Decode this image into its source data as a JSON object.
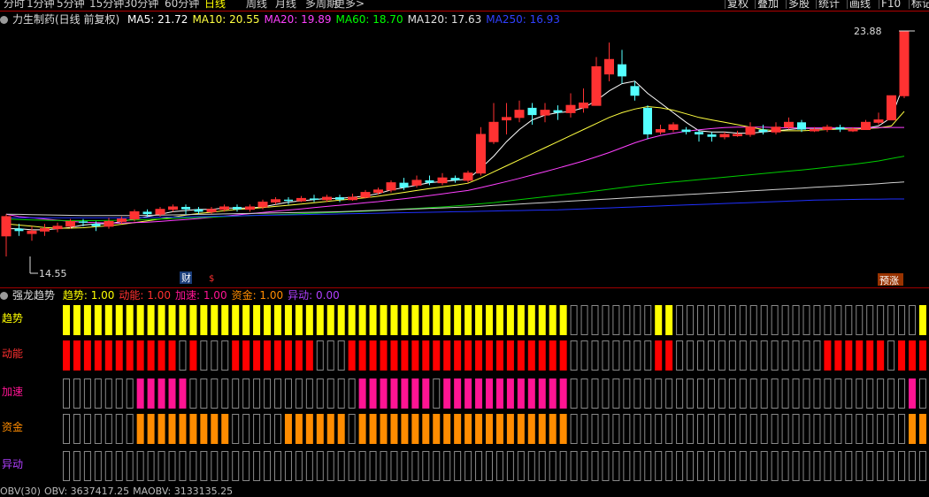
{
  "toolbar": {
    "periods": [
      "分时",
      "1分钟",
      "5分钟",
      "15分钟",
      "30分钟",
      "60分钟",
      "日线",
      "周线",
      "月线",
      "多周期",
      "更多>"
    ],
    "active_period": "日线",
    "buttons": [
      "复权",
      "叠加",
      "多股",
      "统计",
      "画线",
      "F10",
      "标记"
    ]
  },
  "header": {
    "stock": "力生制药(日线 前复权)",
    "ma": [
      {
        "text": "MA5: 21.72",
        "color": "#ffffff"
      },
      {
        "text": "MA10: 20.55",
        "color": "#ffff40"
      },
      {
        "text": "MA20: 19.89",
        "color": "#ff40ff"
      },
      {
        "text": "MA60: 18.70",
        "color": "#00ff00"
      },
      {
        "text": "MA120: 17.63",
        "color": "#e0e0e0"
      },
      {
        "text": "MA250: 16.93",
        "color": "#3040ff"
      }
    ]
  },
  "annotations": {
    "high": "23.88",
    "low": "14.55",
    "cai": "财",
    "dollar": "$",
    "yuzhang": "预涨"
  },
  "colors": {
    "up": "#ff3232",
    "down": "#54ffff",
    "trend": "#ffff00",
    "momentum": "#ff0000",
    "accel": "#ff1493",
    "capital": "#ff8c00",
    "empty": "#888888"
  },
  "candles": [
    [
      15.4,
      16.2,
      16.3,
      14.55
    ],
    [
      15.7,
      15.6,
      15.9,
      15.4
    ],
    [
      15.5,
      15.6,
      15.8,
      15.2
    ],
    [
      15.6,
      15.7,
      15.9,
      15.4
    ],
    [
      15.7,
      15.8,
      15.95,
      15.55
    ],
    [
      15.8,
      16.0,
      16.1,
      15.7
    ],
    [
      16.0,
      15.95,
      16.1,
      15.8
    ],
    [
      15.9,
      15.8,
      16.0,
      15.6
    ],
    [
      15.8,
      16.0,
      16.15,
      15.7
    ],
    [
      16.0,
      16.1,
      16.2,
      15.9
    ],
    [
      16.1,
      16.4,
      16.5,
      16.0
    ],
    [
      16.4,
      16.3,
      16.5,
      16.2
    ],
    [
      16.3,
      16.5,
      16.6,
      16.2
    ],
    [
      16.5,
      16.6,
      16.7,
      16.4
    ],
    [
      16.6,
      16.5,
      16.7,
      16.3
    ],
    [
      16.5,
      16.4,
      16.6,
      16.3
    ],
    [
      16.4,
      16.5,
      16.6,
      16.3
    ],
    [
      16.5,
      16.6,
      16.7,
      16.4
    ],
    [
      16.6,
      16.5,
      16.7,
      16.4
    ],
    [
      16.5,
      16.6,
      16.7,
      16.4
    ],
    [
      16.6,
      16.8,
      16.9,
      16.5
    ],
    [
      16.8,
      16.9,
      17.0,
      16.7
    ],
    [
      16.9,
      16.85,
      17.0,
      16.7
    ],
    [
      16.85,
      16.95,
      17.05,
      16.8
    ],
    [
      16.95,
      16.9,
      17.1,
      16.8
    ],
    [
      16.9,
      17.0,
      17.1,
      16.8
    ],
    [
      17.0,
      16.9,
      17.1,
      16.8
    ],
    [
      16.9,
      17.0,
      17.15,
      16.85
    ],
    [
      17.0,
      17.2,
      17.3,
      16.95
    ],
    [
      17.2,
      17.3,
      17.4,
      17.1
    ],
    [
      17.3,
      17.6,
      17.7,
      17.2
    ],
    [
      17.6,
      17.4,
      17.8,
      17.3
    ],
    [
      17.5,
      17.7,
      17.9,
      17.4
    ],
    [
      17.7,
      17.6,
      17.9,
      17.5
    ],
    [
      17.6,
      17.8,
      18.0,
      17.5
    ],
    [
      17.8,
      17.7,
      17.9,
      17.6
    ],
    [
      17.7,
      18.0,
      18.1,
      17.6
    ],
    [
      18.0,
      19.6,
      19.9,
      17.9
    ],
    [
      19.3,
      20.1,
      20.9,
      19.2
    ],
    [
      20.2,
      20.3,
      20.9,
      19.6
    ],
    [
      20.3,
      20.6,
      21.0,
      20.1
    ],
    [
      20.7,
      20.4,
      20.9,
      20.0
    ],
    [
      20.4,
      20.6,
      20.9,
      20.1
    ],
    [
      20.6,
      20.5,
      20.8,
      20.2
    ],
    [
      20.5,
      20.8,
      21.3,
      20.3
    ],
    [
      20.7,
      20.9,
      21.5,
      20.5
    ],
    [
      20.8,
      22.4,
      22.8,
      20.8
    ],
    [
      22.1,
      22.7,
      23.4,
      21.8
    ],
    [
      22.5,
      22.0,
      23.1,
      21.7
    ],
    [
      21.6,
      21.2,
      21.8,
      21.0
    ],
    [
      20.7,
      19.6,
      20.8,
      19.4
    ],
    [
      19.7,
      19.8,
      20.0,
      19.6
    ],
    [
      19.8,
      20.0,
      20.1,
      19.7
    ],
    [
      19.8,
      19.7,
      19.9,
      19.6
    ],
    [
      19.7,
      19.6,
      19.8,
      19.3
    ],
    [
      19.6,
      19.5,
      19.7,
      19.3
    ],
    [
      19.5,
      19.6,
      19.7,
      19.4
    ],
    [
      19.6,
      19.6,
      19.75,
      19.5
    ],
    [
      19.6,
      19.9,
      20.1,
      19.5
    ],
    [
      19.8,
      19.7,
      20.0,
      19.6
    ],
    [
      19.7,
      19.9,
      20.1,
      19.6
    ],
    [
      19.9,
      20.1,
      20.3,
      19.8
    ],
    [
      20.1,
      19.8,
      20.2,
      19.7
    ],
    [
      19.8,
      19.8,
      19.9,
      19.7
    ],
    [
      19.8,
      19.9,
      20.0,
      19.7
    ],
    [
      19.9,
      19.8,
      20.0,
      19.7
    ],
    [
      19.8,
      19.8,
      19.9,
      19.7
    ],
    [
      19.8,
      20.1,
      20.2,
      19.8
    ],
    [
      20.1,
      20.2,
      20.5,
      20.0
    ],
    [
      20.2,
      21.2,
      21.2,
      20.6
    ],
    [
      21.2,
      23.88,
      23.88,
      21.1
    ]
  ],
  "ma_series": {
    "ma5": [
      15.7,
      15.7,
      15.65,
      15.65,
      15.7,
      15.75,
      15.85,
      15.9,
      15.9,
      16.0,
      16.1,
      16.2,
      16.3,
      16.4,
      16.45,
      16.5,
      16.5,
      16.55,
      16.55,
      16.55,
      16.6,
      16.7,
      16.8,
      16.85,
      16.9,
      16.95,
      16.95,
      17.0,
      17.05,
      17.15,
      17.3,
      17.4,
      17.5,
      17.6,
      17.65,
      17.7,
      17.75,
      18.2,
      18.7,
      19.3,
      19.8,
      20.2,
      20.4,
      20.5,
      20.55,
      20.7,
      21.0,
      21.4,
      21.7,
      21.8,
      21.3,
      20.9,
      20.5,
      20.1,
      19.75,
      19.7,
      19.7,
      19.65,
      19.65,
      19.7,
      19.75,
      19.8,
      19.85,
      19.85,
      19.85,
      19.85,
      19.8,
      19.85,
      19.95,
      20.3,
      21.72
    ],
    "ma10": [
      15.9,
      15.85,
      15.8,
      15.75,
      15.72,
      15.72,
      15.74,
      15.78,
      15.82,
      15.88,
      15.95,
      16.02,
      16.1,
      16.18,
      16.26,
      16.33,
      16.38,
      16.44,
      16.5,
      16.53,
      16.57,
      16.62,
      16.67,
      16.72,
      16.77,
      16.83,
      16.88,
      16.93,
      16.98,
      17.04,
      17.12,
      17.2,
      17.28,
      17.36,
      17.43,
      17.5,
      17.58,
      17.8,
      18.05,
      18.3,
      18.55,
      18.8,
      19.05,
      19.3,
      19.55,
      19.8,
      20.05,
      20.3,
      20.5,
      20.65,
      20.75,
      20.7,
      20.6,
      20.45,
      20.3,
      20.2,
      20.1,
      20.0,
      19.9,
      19.8,
      19.75,
      19.75,
      19.75,
      19.77,
      19.8,
      19.82,
      19.82,
      19.84,
      19.87,
      19.95,
      20.55
    ],
    "ma20": [
      16.3,
      16.2,
      16.15,
      16.1,
      16.05,
      16.0,
      15.97,
      15.95,
      15.93,
      15.93,
      15.95,
      15.97,
      16.0,
      16.04,
      16.08,
      16.12,
      16.17,
      16.22,
      16.27,
      16.32,
      16.37,
      16.42,
      16.47,
      16.52,
      16.57,
      16.62,
      16.67,
      16.72,
      16.77,
      16.82,
      16.88,
      16.94,
      17.0,
      17.07,
      17.14,
      17.21,
      17.28,
      17.4,
      17.52,
      17.65,
      17.78,
      17.92,
      18.06,
      18.2,
      18.35,
      18.5,
      18.67,
      18.85,
      19.05,
      19.25,
      19.42,
      19.55,
      19.65,
      19.73,
      19.79,
      19.84,
      19.88,
      19.9,
      19.9,
      19.9,
      19.88,
      19.87,
      19.87,
      19.87,
      19.87,
      19.87,
      19.87,
      19.87,
      19.88,
      19.89,
      19.89
    ],
    "ma60": [
      16.1,
      16.08,
      16.06,
      16.05,
      16.04,
      16.03,
      16.03,
      16.03,
      16.04,
      16.05,
      16.06,
      16.08,
      16.1,
      16.12,
      16.14,
      16.16,
      16.18,
      16.2,
      16.22,
      16.24,
      16.26,
      16.28,
      16.3,
      16.32,
      16.34,
      16.36,
      16.38,
      16.4,
      16.42,
      16.45,
      16.48,
      16.51,
      16.54,
      16.57,
      16.6,
      16.64,
      16.68,
      16.73,
      16.78,
      16.84,
      16.9,
      16.96,
      17.02,
      17.08,
      17.14,
      17.2,
      17.26,
      17.33,
      17.4,
      17.47,
      17.53,
      17.58,
      17.63,
      17.68,
      17.73,
      17.78,
      17.83,
      17.88,
      17.93,
      17.98,
      18.03,
      18.08,
      18.13,
      18.18,
      18.24,
      18.3,
      18.36,
      18.43,
      18.5,
      18.6,
      18.7
    ],
    "ma120": [
      16.3,
      16.29,
      16.28,
      16.27,
      16.26,
      16.25,
      16.24,
      16.24,
      16.24,
      16.24,
      16.24,
      16.25,
      16.26,
      16.27,
      16.28,
      16.29,
      16.3,
      16.31,
      16.32,
      16.33,
      16.34,
      16.35,
      16.36,
      16.37,
      16.38,
      16.39,
      16.4,
      16.42,
      16.44,
      16.46,
      16.48,
      16.5,
      16.52,
      16.54,
      16.56,
      16.58,
      16.6,
      16.63,
      16.66,
      16.69,
      16.72,
      16.75,
      16.78,
      16.81,
      16.84,
      16.87,
      16.9,
      16.93,
      16.96,
      16.99,
      17.02,
      17.05,
      17.08,
      17.11,
      17.14,
      17.17,
      17.2,
      17.23,
      17.26,
      17.29,
      17.32,
      17.35,
      17.38,
      17.41,
      17.44,
      17.47,
      17.5,
      17.53,
      17.56,
      17.6,
      17.63
    ],
    "ma250": [
      16.15,
      16.15,
      16.15,
      16.15,
      16.15,
      16.15,
      16.15,
      16.15,
      16.15,
      16.15,
      16.15,
      16.16,
      16.17,
      16.18,
      16.19,
      16.2,
      16.21,
      16.22,
      16.23,
      16.24,
      16.25,
      16.26,
      16.27,
      16.28,
      16.29,
      16.3,
      16.31,
      16.32,
      16.33,
      16.34,
      16.35,
      16.36,
      16.37,
      16.38,
      16.39,
      16.4,
      16.41,
      16.42,
      16.43,
      16.44,
      16.45,
      16.46,
      16.47,
      16.48,
      16.5,
      16.52,
      16.54,
      16.56,
      16.58,
      16.6,
      16.62,
      16.64,
      16.66,
      16.68,
      16.7,
      16.72,
      16.74,
      16.76,
      16.78,
      16.8,
      16.82,
      16.84,
      16.86,
      16.88,
      16.89,
      16.9,
      16.91,
      16.92,
      16.92,
      16.93,
      16.93
    ]
  },
  "indicator": {
    "name": "强龙趋势",
    "values": [
      {
        "text": "趋势: 1.00",
        "color": "#ffff00"
      },
      {
        "text": "动能: 1.00",
        "color": "#ff3030"
      },
      {
        "text": "加速: 1.00",
        "color": "#ff1493"
      },
      {
        "text": "资金: 1.00",
        "color": "#ff8c00"
      },
      {
        "text": "异动: 0.00",
        "color": "#b040ff"
      }
    ],
    "row_labels": [
      {
        "text": "趋势",
        "color": "#ffff00"
      },
      {
        "text": "动能",
        "color": "#ff3030"
      },
      {
        "text": "加速",
        "color": "#ff1493"
      },
      {
        "text": "资金",
        "color": "#ff8c00"
      },
      {
        "text": "异动",
        "color": "#b040ff"
      }
    ],
    "rows": [
      "111111111111111111111111111111111111111111111111000000001100000000000000000000000111",
      "111111111110100011111111000111111111111111111111000000001100000000000000111111011111",
      "000000011111000000000000000011111110111111111111000000000000000000000000000000001011",
      "000000011111111100000111111011111111111111111111000000000000000000000000000000001111",
      "000000000000000000000000000000000000000000000000000000000000000000000000000000000000"
    ]
  },
  "bottom": [
    "OBV(30)",
    "OBV: 3637417.25",
    "MAOBV: 3133135.25"
  ]
}
